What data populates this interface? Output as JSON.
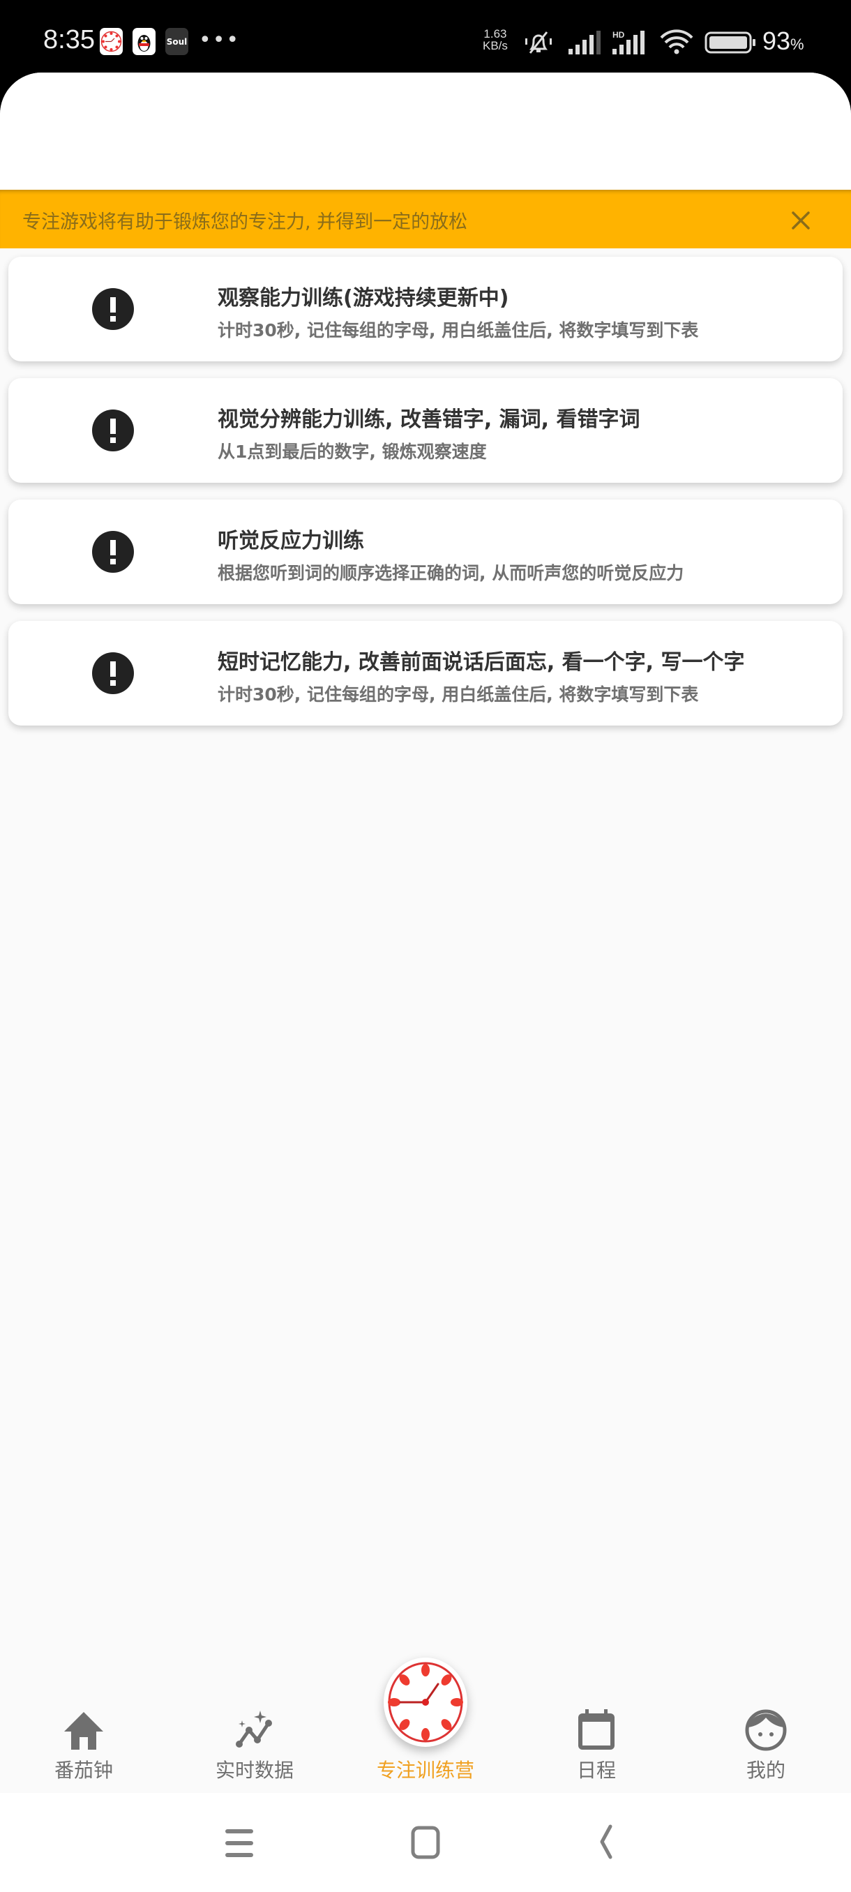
{
  "status_bar": {
    "time": "8:35",
    "notification_icons": [
      "pomodoro-clock-app-icon",
      "qq-app-icon",
      "soul-app-icon"
    ],
    "soul_label": "Soul",
    "more": "•••",
    "net_speed_value": "1.63",
    "net_speed_unit": "KB/s",
    "battery_percent": "93",
    "battery_suffix": "%"
  },
  "banner": {
    "text": "专注游戏将有助于锻炼您的专注力, 并得到一定的放松",
    "color": "#ffb300"
  },
  "cards": [
    {
      "icon": "alert-circle-icon",
      "title": "观察能力训练(游戏持续更新中)",
      "subtitle": "计时30秒, 记住每组的字母, 用白纸盖住后, 将数字填写到下表"
    },
    {
      "icon": "alert-circle-icon",
      "title": "视觉分辨能力训练, 改善错字, 漏词, 看错字词",
      "subtitle": "从1点到最后的数字, 锻炼观察速度"
    },
    {
      "icon": "alert-circle-icon",
      "title": "听觉反应力训练",
      "subtitle": "根据您听到词的顺序选择正确的词, 从而听声您的听觉反应力"
    },
    {
      "icon": "alert-circle-icon",
      "title": "短时记忆能力, 改善前面说话后面忘, 看一个字, 写一个字",
      "subtitle": "计时30秒, 记住每组的字母, 用白纸盖住后, 将数字填写到下表"
    }
  ],
  "bottom_nav": {
    "active_color": "#f0a020",
    "inactive_color": "#6f6f6f",
    "items": [
      {
        "label": "番茄钟",
        "icon": "home-icon",
        "active": false
      },
      {
        "label": "实时数据",
        "icon": "sparkle-chart-icon",
        "active": false
      },
      {
        "label": "专注训练营",
        "icon": "tomato-clock-icon",
        "active": true
      },
      {
        "label": "日程",
        "icon": "calendar-icon",
        "active": false
      },
      {
        "label": "我的",
        "icon": "face-icon",
        "active": false
      }
    ]
  },
  "system_nav": [
    "recents-icon",
    "home-square-icon",
    "back-icon"
  ]
}
